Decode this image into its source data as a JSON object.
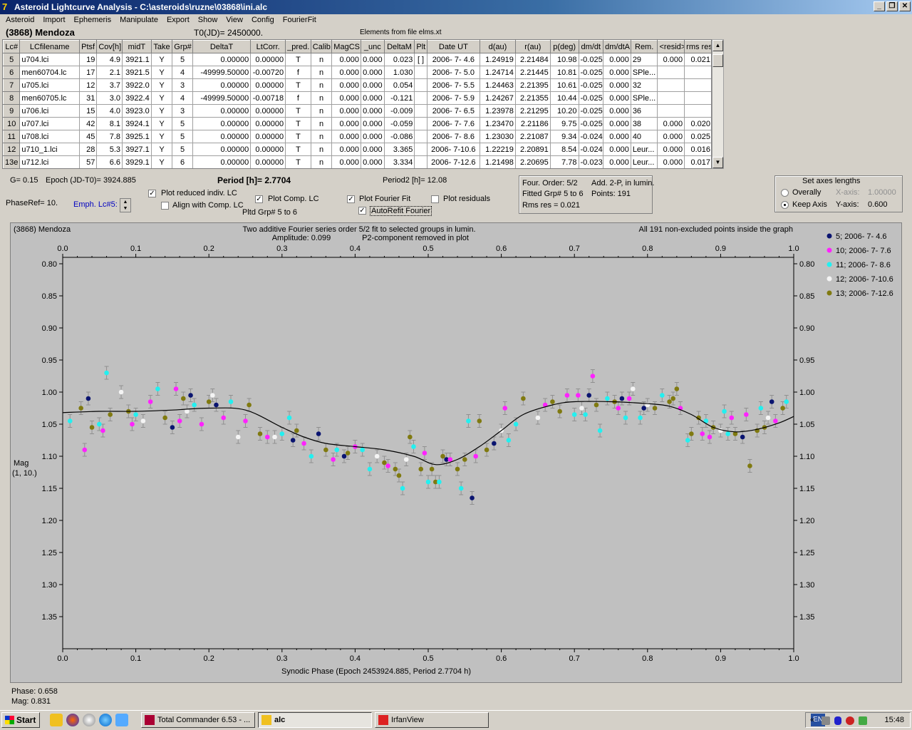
{
  "window": {
    "title": "Asteroid Lightcurve Analysis - C:\\asteroids\\ruzne\\03868\\ini.alc",
    "min": "_",
    "max": "❐",
    "close": "✕"
  },
  "menu": [
    "Asteroid",
    "Import",
    "Ephemeris",
    "Manipulate",
    "Export",
    "Show",
    "View",
    "Config",
    "FourierFit"
  ],
  "header": {
    "asteroid": "(3868) Mendoza",
    "t0": "T0(JD)= 2450000.",
    "elements": "Elements from file elms.xt"
  },
  "table": {
    "columns": [
      "Lc#",
      "LCfilename",
      "Ptsf",
      "Cov[h]",
      "midT",
      "Take",
      "Grp#",
      "DeltaT",
      "LtCorr.",
      "_pred.",
      "Calib.",
      "MagCS",
      "_unc",
      "DeltaM",
      "Plt",
      "Date UT",
      "d(au)",
      "r(au)",
      "p(deg)",
      "dm/dt",
      "dm/dtA",
      "Rem.",
      "<resid>",
      "rms res"
    ],
    "rows": [
      [
        "5",
        "u704.lci",
        "19",
        "4.9",
        "3921.1",
        "Y",
        "5",
        "0.00000",
        "0.00000",
        "T",
        "n",
        "0.000",
        "0.000",
        "0.023",
        "[ ]",
        "2006- 7- 4.6",
        "1.24919",
        "2.21484",
        "10.98",
        "-0.025",
        "0.000",
        "29",
        "0.000",
        "0.021"
      ],
      [
        "6",
        "men60704.lc",
        "17",
        "2.1",
        "3921.5",
        "Y",
        "4",
        "-49999.50000",
        "-0.00720",
        "f",
        "n",
        "0.000",
        "0.000",
        "1.030",
        "",
        "2006- 7- 5.0",
        "1.24714",
        "2.21445",
        "10.81",
        "-0.025",
        "0.000",
        "SPle...",
        "",
        ""
      ],
      [
        "7",
        "u705.lci",
        "12",
        "3.7",
        "3922.0",
        "Y",
        "3",
        "0.00000",
        "0.00000",
        "T",
        "n",
        "0.000",
        "0.000",
        "0.054",
        "",
        "2006- 7- 5.5",
        "1.24463",
        "2.21395",
        "10.61",
        "-0.025",
        "0.000",
        "32",
        "",
        ""
      ],
      [
        "8",
        "men60705.lc",
        "31",
        "3.0",
        "3922.4",
        "Y",
        "4",
        "-49999.50000",
        "-0.00718",
        "f",
        "n",
        "0.000",
        "0.000",
        "-0.121",
        "",
        "2006- 7- 5.9",
        "1.24267",
        "2.21355",
        "10.44",
        "-0.025",
        "0.000",
        "SPle...",
        "",
        ""
      ],
      [
        "9",
        "u706.lci",
        "15",
        "4.0",
        "3923.0",
        "Y",
        "3",
        "0.00000",
        "0.00000",
        "T",
        "n",
        "0.000",
        "0.000",
        "-0.009",
        "",
        "2006- 7- 6.5",
        "1.23978",
        "2.21295",
        "10.20",
        "-0.025",
        "0.000",
        "36",
        "",
        ""
      ],
      [
        "10",
        "u707.lci",
        "42",
        "8.1",
        "3924.1",
        "Y",
        "5",
        "0.00000",
        "0.00000",
        "T",
        "n",
        "0.000",
        "0.000",
        "-0.059",
        "",
        "2006- 7- 7.6",
        "1.23470",
        "2.21186",
        "9.75",
        "-0.025",
        "0.000",
        "38",
        "0.000",
        "0.020"
      ],
      [
        "11",
        "u708.lci",
        "45",
        "7.8",
        "3925.1",
        "Y",
        "5",
        "0.00000",
        "0.00000",
        "T",
        "n",
        "0.000",
        "0.000",
        "-0.086",
        "",
        "2006- 7- 8.6",
        "1.23030",
        "2.21087",
        "9.34",
        "-0.024",
        "0.000",
        "40",
        "0.000",
        "0.025"
      ],
      [
        "12",
        "u710_1.lci",
        "28",
        "5.3",
        "3927.1",
        "Y",
        "5",
        "0.00000",
        "0.00000",
        "T",
        "n",
        "0.000",
        "0.000",
        "3.365",
        "",
        "2006- 7-10.6",
        "1.22219",
        "2.20891",
        "8.54",
        "-0.024",
        "0.000",
        "Leur...",
        "0.000",
        "0.016"
      ],
      [
        "13e",
        "u712.lci",
        "57",
        "6.6",
        "3929.1",
        "Y",
        "6",
        "0.00000",
        "0.00000",
        "T",
        "n",
        "0.000",
        "0.000",
        "3.334",
        "",
        "2006- 7-12.6",
        "1.21498",
        "2.20695",
        "7.78",
        "-0.023",
        "0.000",
        "Leur...",
        "0.000",
        "0.017"
      ]
    ]
  },
  "controls": {
    "g": "G= 0.15",
    "epoch": "Epoch (JD-T0)= 3924.885",
    "period": "Period [h]= 2.7704",
    "period2": "Period2 [h]= 12.08",
    "phaseref": "PhaseRef= 10.",
    "emph": "Emph. Lc#5:",
    "plot_reduced": "Plot reduced indiv. LC",
    "align_comp": "Align with Comp. LC",
    "plot_comp": "Plot Comp. LC",
    "pltd_grp": "Pltd Grp#  5   to   6",
    "plot_fourier": "Plot Fourier Fit",
    "autorefit": "AutoRefit Fourier",
    "plot_residuals": "Plot residuals",
    "four_order": "Four. Order:  5/2",
    "add2p": "Add. 2-P, in lumin.",
    "fitted": "Fitted Grp# 5 to 6",
    "points": "Points: 191",
    "rms": "Rms res       = 0.021",
    "axes_title": "Set axes lengths",
    "overally": "Overally",
    "keep_axis": "Keep Axis",
    "xaxis": "X-axis:",
    "xval": "1.00000",
    "yaxis": "Y-axis:",
    "yval": "0.600"
  },
  "plot": {
    "name": "(3868) Mendoza",
    "desc1": "Two additive Fourier series order 5/2 fit to selected groups in lumin.",
    "desc2": "Amplitude: 0.099",
    "desc3": "P2-component removed in plot",
    "inside": "All 191 non-excluded points inside the graph",
    "xlabel": "Synodic Phase (Epoch 2453924.885, Period 2.7704 h)",
    "ylabel1": "Mag",
    "ylabel2": "(1, 10.)"
  },
  "chart_data": {
    "type": "scatter",
    "xlim": [
      0,
      1
    ],
    "ylim": [
      1.4,
      0.79
    ],
    "xticks": [
      "0.0",
      "0.1",
      "0.2",
      "0.3",
      "0.4",
      "0.5",
      "0.6",
      "0.7",
      "0.8",
      "0.9",
      "1.0"
    ],
    "yticks": [
      "0.80",
      "0.85",
      "0.90",
      "0.95",
      "1.00",
      "1.05",
      "1.10",
      "1.15",
      "1.20",
      "1.25",
      "1.30",
      "1.35"
    ],
    "legend": [
      {
        "name": "5; 2006- 7- 4.6",
        "color": "#0a1470"
      },
      {
        "name": "10; 2006- 7- 7.6",
        "color": "#ff22ff"
      },
      {
        "name": "11; 2006- 7- 8.6",
        "color": "#22f0f0"
      },
      {
        "name": "12; 2006- 7-10.6",
        "color": "#f4f4f4"
      },
      {
        "name": "13; 2006- 7-12.6",
        "color": "#807a10"
      }
    ],
    "fit": [
      [
        0,
        1.032
      ],
      [
        0.05,
        1.03
      ],
      [
        0.1,
        1.03
      ],
      [
        0.15,
        1.028
      ],
      [
        0.2,
        1.025
      ],
      [
        0.25,
        1.028
      ],
      [
        0.3,
        1.055
      ],
      [
        0.33,
        1.07
      ],
      [
        0.36,
        1.08
      ],
      [
        0.4,
        1.085
      ],
      [
        0.44,
        1.09
      ],
      [
        0.48,
        1.1
      ],
      [
        0.51,
        1.113
      ],
      [
        0.54,
        1.105
      ],
      [
        0.57,
        1.085
      ],
      [
        0.6,
        1.06
      ],
      [
        0.63,
        1.035
      ],
      [
        0.67,
        1.02
      ],
      [
        0.7,
        1.015
      ],
      [
        0.75,
        1.015
      ],
      [
        0.8,
        1.018
      ],
      [
        0.83,
        1.022
      ],
      [
        0.86,
        1.035
      ],
      [
        0.89,
        1.055
      ],
      [
        0.92,
        1.062
      ],
      [
        0.95,
        1.058
      ],
      [
        0.98,
        1.048
      ],
      [
        1.0,
        1.038
      ]
    ],
    "points": [
      [
        0.01,
        1.045,
        2
      ],
      [
        0.025,
        1.025,
        4
      ],
      [
        0.03,
        1.09,
        1
      ],
      [
        0.035,
        1.01,
        0
      ],
      [
        0.04,
        1.055,
        4
      ],
      [
        0.05,
        1.05,
        2
      ],
      [
        0.055,
        1.06,
        1
      ],
      [
        0.06,
        0.97,
        2
      ],
      [
        0.065,
        1.035,
        4
      ],
      [
        0.08,
        1.0,
        3
      ],
      [
        0.09,
        1.03,
        4
      ],
      [
        0.095,
        1.05,
        1
      ],
      [
        0.1,
        1.035,
        2
      ],
      [
        0.11,
        1.045,
        3
      ],
      [
        0.12,
        1.015,
        1
      ],
      [
        0.13,
        0.995,
        2
      ],
      [
        0.14,
        1.04,
        4
      ],
      [
        0.15,
        1.055,
        0
      ],
      [
        0.155,
        0.995,
        1
      ],
      [
        0.16,
        1.045,
        1
      ],
      [
        0.165,
        1.01,
        4
      ],
      [
        0.17,
        1.03,
        3
      ],
      [
        0.175,
        1.005,
        0
      ],
      [
        0.18,
        1.02,
        2
      ],
      [
        0.19,
        1.05,
        1
      ],
      [
        0.2,
        1.015,
        4
      ],
      [
        0.205,
        1.005,
        3
      ],
      [
        0.21,
        1.02,
        0
      ],
      [
        0.22,
        1.04,
        1
      ],
      [
        0.23,
        1.015,
        2
      ],
      [
        0.24,
        1.07,
        3
      ],
      [
        0.25,
        1.045,
        1
      ],
      [
        0.255,
        1.02,
        4
      ],
      [
        0.27,
        1.065,
        4
      ],
      [
        0.28,
        1.07,
        1
      ],
      [
        0.29,
        1.07,
        3
      ],
      [
        0.3,
        1.065,
        2
      ],
      [
        0.31,
        1.04,
        2
      ],
      [
        0.315,
        1.075,
        0
      ],
      [
        0.32,
        1.06,
        4
      ],
      [
        0.33,
        1.08,
        1
      ],
      [
        0.34,
        1.1,
        2
      ],
      [
        0.35,
        1.065,
        0
      ],
      [
        0.36,
        1.09,
        4
      ],
      [
        0.37,
        1.105,
        1
      ],
      [
        0.375,
        1.09,
        2
      ],
      [
        0.385,
        1.1,
        0
      ],
      [
        0.39,
        1.095,
        4
      ],
      [
        0.4,
        1.085,
        1
      ],
      [
        0.41,
        1.09,
        2
      ],
      [
        0.42,
        1.12,
        2
      ],
      [
        0.43,
        1.1,
        3
      ],
      [
        0.44,
        1.11,
        4
      ],
      [
        0.445,
        1.115,
        1
      ],
      [
        0.455,
        1.12,
        4
      ],
      [
        0.46,
        1.13,
        4
      ],
      [
        0.465,
        1.15,
        2
      ],
      [
        0.47,
        1.105,
        3
      ],
      [
        0.475,
        1.07,
        4
      ],
      [
        0.48,
        1.085,
        2
      ],
      [
        0.49,
        1.12,
        4
      ],
      [
        0.495,
        1.095,
        1
      ],
      [
        0.5,
        1.14,
        2
      ],
      [
        0.505,
        1.12,
        4
      ],
      [
        0.51,
        1.14,
        4
      ],
      [
        0.515,
        1.14,
        2
      ],
      [
        0.52,
        1.1,
        4
      ],
      [
        0.525,
        1.105,
        0
      ],
      [
        0.53,
        1.105,
        1
      ],
      [
        0.54,
        1.12,
        4
      ],
      [
        0.545,
        1.15,
        2
      ],
      [
        0.55,
        1.105,
        4
      ],
      [
        0.555,
        1.045,
        2
      ],
      [
        0.56,
        1.165,
        0
      ],
      [
        0.565,
        1.1,
        1
      ],
      [
        0.57,
        1.045,
        4
      ],
      [
        0.58,
        1.09,
        4
      ],
      [
        0.59,
        1.08,
        0
      ],
      [
        0.6,
        1.06,
        3
      ],
      [
        0.605,
        1.025,
        1
      ],
      [
        0.61,
        1.075,
        2
      ],
      [
        0.62,
        1.05,
        2
      ],
      [
        0.63,
        1.01,
        4
      ],
      [
        0.65,
        1.04,
        3
      ],
      [
        0.66,
        1.02,
        1
      ],
      [
        0.67,
        1.015,
        4
      ],
      [
        0.68,
        1.03,
        4
      ],
      [
        0.69,
        1.005,
        1
      ],
      [
        0.7,
        1.035,
        2
      ],
      [
        0.705,
        1.005,
        1
      ],
      [
        0.71,
        1.025,
        3
      ],
      [
        0.715,
        1.035,
        2
      ],
      [
        0.72,
        1.005,
        0
      ],
      [
        0.725,
        0.975,
        1
      ],
      [
        0.73,
        1.02,
        4
      ],
      [
        0.735,
        1.06,
        2
      ],
      [
        0.745,
        1.01,
        2
      ],
      [
        0.755,
        1.015,
        4
      ],
      [
        0.76,
        1.025,
        1
      ],
      [
        0.765,
        1.01,
        0
      ],
      [
        0.77,
        1.04,
        2
      ],
      [
        0.775,
        1.01,
        1
      ],
      [
        0.78,
        0.995,
        3
      ],
      [
        0.79,
        1.04,
        2
      ],
      [
        0.795,
        1.025,
        0
      ],
      [
        0.8,
        1.02,
        3
      ],
      [
        0.81,
        1.025,
        4
      ],
      [
        0.82,
        1.005,
        2
      ],
      [
        0.83,
        1.015,
        4
      ],
      [
        0.835,
        1.01,
        4
      ],
      [
        0.84,
        0.995,
        4
      ],
      [
        0.845,
        1.025,
        1
      ],
      [
        0.855,
        1.075,
        2
      ],
      [
        0.86,
        1.065,
        4
      ],
      [
        0.87,
        1.04,
        4
      ],
      [
        0.875,
        1.065,
        1
      ],
      [
        0.88,
        1.045,
        2
      ],
      [
        0.885,
        1.07,
        1
      ],
      [
        0.89,
        1.055,
        4
      ],
      [
        0.9,
        1.06,
        3
      ],
      [
        0.905,
        1.03,
        2
      ],
      [
        0.91,
        1.065,
        2
      ],
      [
        0.915,
        1.04,
        1
      ],
      [
        0.92,
        1.065,
        4
      ],
      [
        0.93,
        1.07,
        0
      ],
      [
        0.935,
        1.035,
        1
      ],
      [
        0.94,
        1.115,
        4
      ],
      [
        0.95,
        1.06,
        4
      ],
      [
        0.955,
        1.025,
        2
      ],
      [
        0.96,
        1.055,
        4
      ],
      [
        0.965,
        1.04,
        3
      ],
      [
        0.97,
        1.015,
        0
      ],
      [
        0.975,
        1.045,
        1
      ],
      [
        0.985,
        1.025,
        4
      ],
      [
        0.99,
        1.015,
        2
      ]
    ]
  },
  "status": {
    "phase": "Phase: 0.658",
    "mag": "Mag:   0.831"
  },
  "taskbar": {
    "start": "Start",
    "tasks": [
      "Total Commander 6.53 - ...",
      "alc",
      "IrfanView"
    ],
    "lang": "EN",
    "clock": "15:48"
  }
}
